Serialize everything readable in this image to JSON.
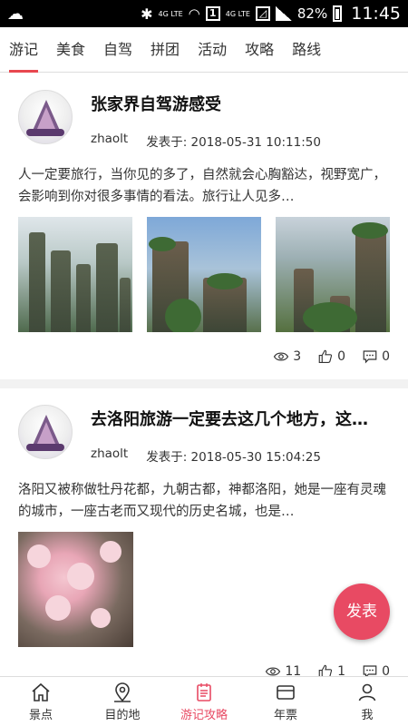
{
  "status_bar": {
    "network_label": "4G LTE",
    "network_label_2": "4G LTE",
    "sim_badge": "1",
    "battery": "82%",
    "time": "11:45"
  },
  "tabs": [
    {
      "label": "游记",
      "active": true
    },
    {
      "label": "美食",
      "active": false
    },
    {
      "label": "自驾",
      "active": false
    },
    {
      "label": "拼团",
      "active": false
    },
    {
      "label": "活动",
      "active": false
    },
    {
      "label": "攻略",
      "active": false
    },
    {
      "label": "路线",
      "active": false
    }
  ],
  "posts": [
    {
      "title": "张家界自驾游感受",
      "author": "zhaolt",
      "posted": "发表于: 2018-05-31 10:11:50",
      "excerpt": "人一定要旅行，当你见的多了，自然就会心胸豁达，视野宽广，会影响到你对很多事情的看法。旅行让人见多…",
      "views": "3",
      "likes": "0",
      "comments": "0"
    },
    {
      "title": "去洛阳旅游一定要去这几个地方，这…",
      "author": "zhaolt",
      "posted": "发表于: 2018-05-30 15:04:25",
      "excerpt": "洛阳又被称做牡丹花都，九朝古都，神都洛阳，她是一座有灵魂的城市，一座古老而又现代的历史名城，也是…",
      "views": "11",
      "likes": "1",
      "comments": "0"
    }
  ],
  "fab_label": "发表",
  "bottom_nav": [
    {
      "label": "景点",
      "icon": "home-icon"
    },
    {
      "label": "目的地",
      "icon": "location-pin-icon"
    },
    {
      "label": "游记攻略",
      "icon": "notebook-icon",
      "active": true
    },
    {
      "label": "年票",
      "icon": "card-icon"
    },
    {
      "label": "我",
      "icon": "person-icon"
    }
  ],
  "colors": {
    "accent": "#e8474f",
    "fab": "#e84a63"
  }
}
